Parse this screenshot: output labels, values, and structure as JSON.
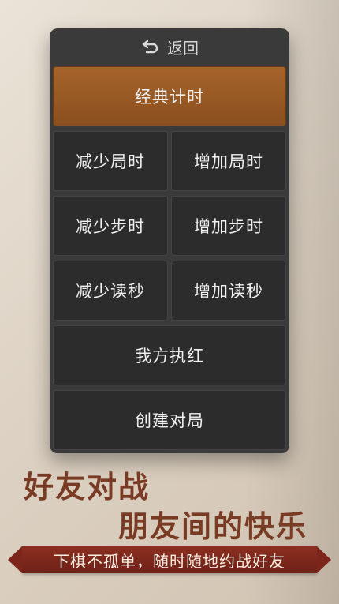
{
  "panel": {
    "back_label": "返回",
    "classic_timer": "经典计时",
    "decrease_round_time": "减少局时",
    "increase_round_time": "增加局时",
    "decrease_step_time": "减少步时",
    "increase_step_time": "增加步时",
    "decrease_read_seconds": "减少读秒",
    "increase_read_seconds": "增加读秒",
    "my_side_red": "我方执红",
    "create_match": "创建对局"
  },
  "promo": {
    "line1": "好友对战",
    "line2": "朋友间的快乐",
    "ribbon": "下棋不孤单，随时随地约战好友"
  },
  "colors": {
    "panel_bg": "#3a3a3a",
    "button_dark": "#2c2c2c",
    "button_highlight": "#a6642b",
    "promo_text": "#7a3b25",
    "ribbon_bg": "#8b2f21"
  }
}
